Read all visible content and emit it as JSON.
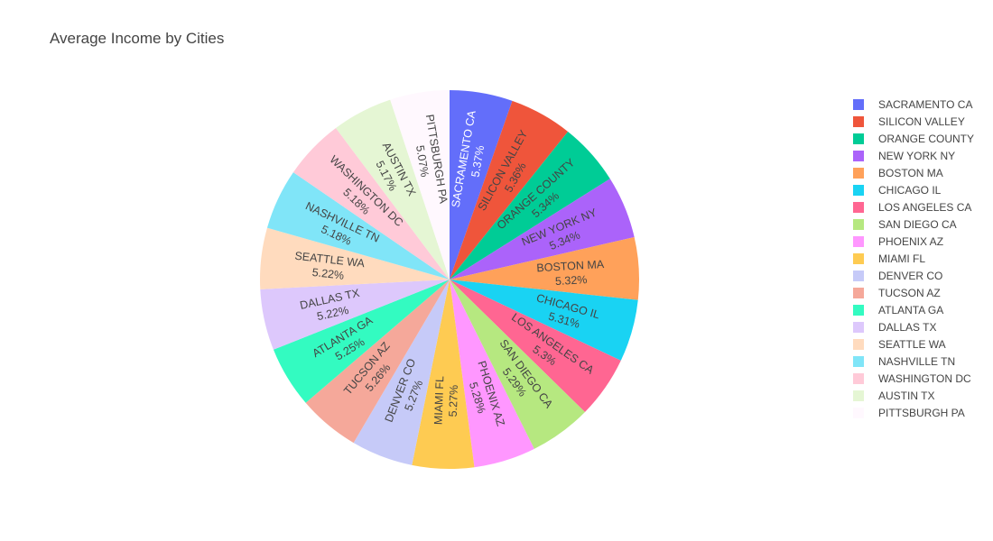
{
  "chart_data": {
    "type": "pie",
    "title": "Average Income by Cities",
    "slices": [
      {
        "label": "SACRAMENTO CA",
        "percent_label": "5.37%",
        "value": 5.37,
        "color": "#636efa"
      },
      {
        "label": "SILICON VALLEY",
        "percent_label": "5.36%",
        "value": 5.36,
        "color": "#EF553B"
      },
      {
        "label": "ORANGE COUNTY",
        "percent_label": "5.34%",
        "value": 5.34,
        "color": "#00cc96"
      },
      {
        "label": "NEW YORK NY",
        "percent_label": "5.34%",
        "value": 5.34,
        "color": "#ab63fa"
      },
      {
        "label": "BOSTON MA",
        "percent_label": "5.32%",
        "value": 5.32,
        "color": "#FFA15A"
      },
      {
        "label": "CHICAGO IL",
        "percent_label": "5.31%",
        "value": 5.31,
        "color": "#19d3f3"
      },
      {
        "label": "LOS ANGELES CA",
        "percent_label": "5.3%",
        "value": 5.3,
        "color": "#FF6692"
      },
      {
        "label": "SAN DIEGO CA",
        "percent_label": "5.29%",
        "value": 5.29,
        "color": "#B6E880"
      },
      {
        "label": "PHOENIX AZ",
        "percent_label": "5.28%",
        "value": 5.28,
        "color": "#FF97FF"
      },
      {
        "label": "MIAMI FL",
        "percent_label": "5.27%",
        "value": 5.27,
        "color": "#FECB52"
      },
      {
        "label": "DENVER CO",
        "percent_label": "5.27%",
        "value": 5.27,
        "color": "#c6caf8"
      },
      {
        "label": "TUCSON AZ",
        "percent_label": "5.26%",
        "value": 5.26,
        "color": "#f5a89a"
      },
      {
        "label": "ATLANTA GA",
        "percent_label": "5.25%",
        "value": 5.25,
        "color": "#33fbc1"
      },
      {
        "label": "DALLAS TX",
        "percent_label": "5.22%",
        "value": 5.22,
        "color": "#ddc8fc"
      },
      {
        "label": "SEATTLE WA",
        "percent_label": "5.22%",
        "value": 5.22,
        "color": "#ffdbbe"
      },
      {
        "label": "NASHVILLE TN",
        "percent_label": "5.18%",
        "value": 5.18,
        "color": "#80e5f8"
      },
      {
        "label": "WASHINGTON DC",
        "percent_label": "5.18%",
        "value": 5.18,
        "color": "#ffcad8"
      },
      {
        "label": "AUSTIN TX",
        "percent_label": "5.17%",
        "value": 5.17,
        "color": "#e5f6d4"
      },
      {
        "label": "PITTSBURGH PA",
        "percent_label": "5.07%",
        "value": 5.07,
        "color": "#fff8fe"
      }
    ],
    "legend_position": "right",
    "direction": "clockwise",
    "start": "top"
  }
}
